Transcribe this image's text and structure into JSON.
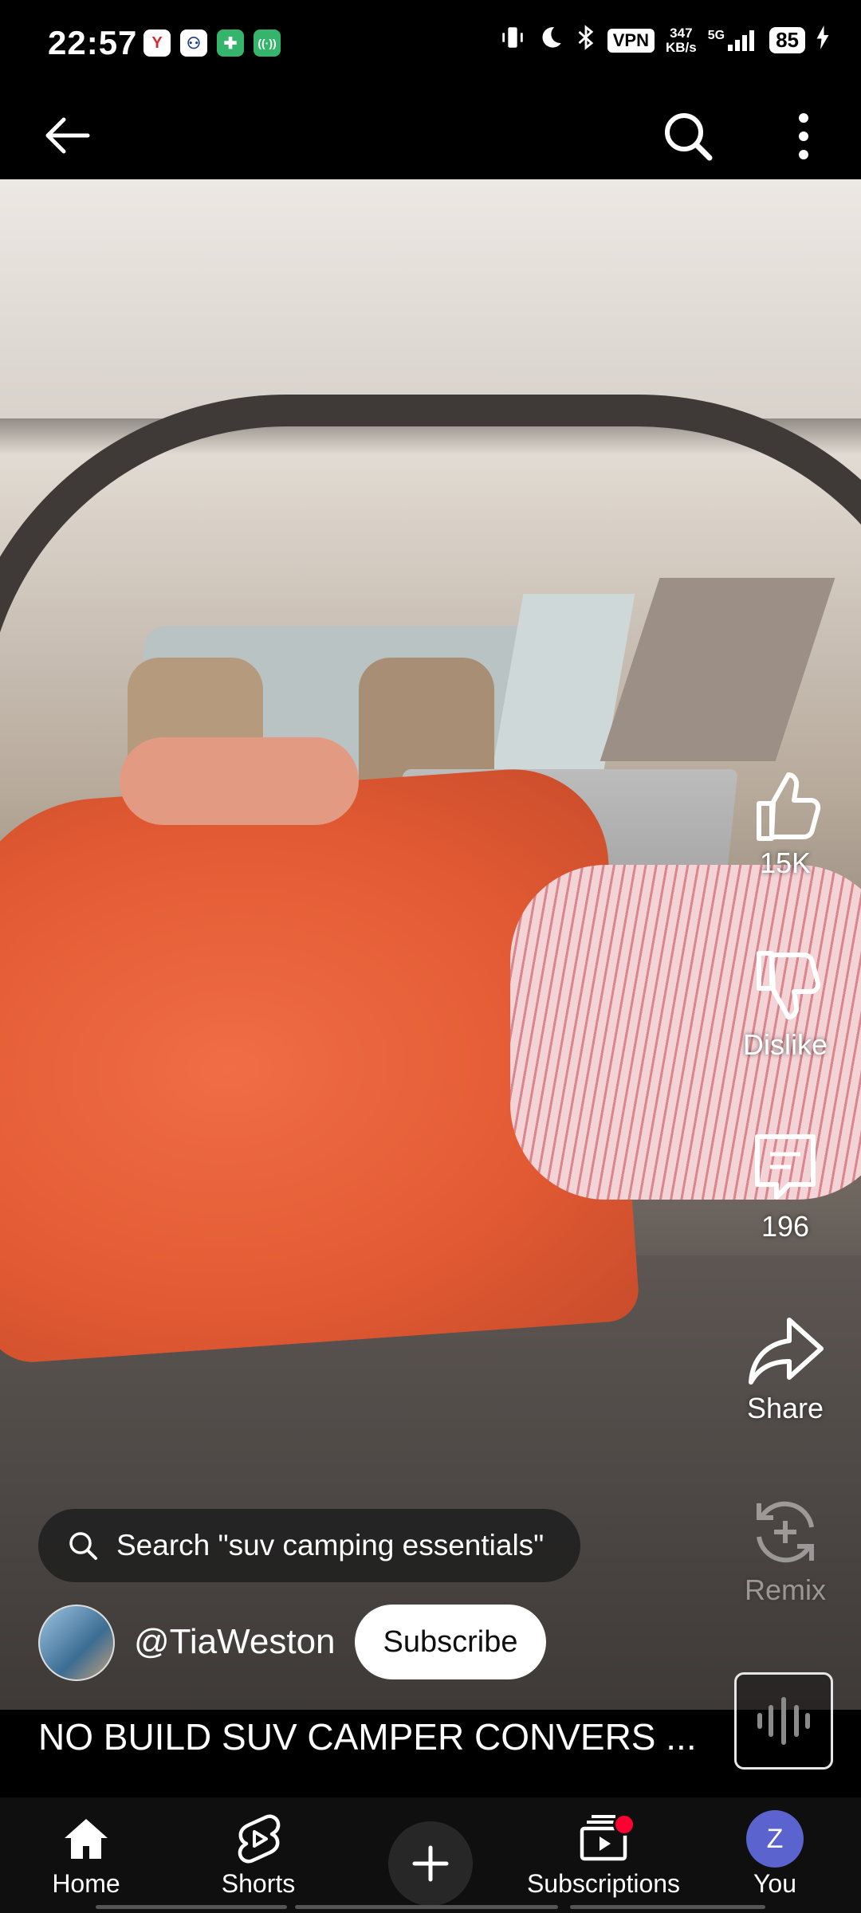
{
  "status_bar": {
    "time": "22:57",
    "app_badges": [
      "Y",
      "⚇",
      "✚",
      "((·))"
    ],
    "vpn": "VPN",
    "speed_value": "347",
    "speed_unit": "KB/s",
    "network": "5G",
    "battery": "85"
  },
  "top_bar": {
    "back_icon": "arrow-left-icon",
    "search_icon": "search-icon",
    "more_icon": "more-vert-icon"
  },
  "actions": {
    "like_count": "15K",
    "dislike_label": "Dislike",
    "comments_count": "196",
    "share_label": "Share",
    "remix_label": "Remix"
  },
  "search_suggestion": "Search \"suv camping essentials\"",
  "channel": {
    "handle": "@TiaWeston",
    "subscribe_label": "Subscribe"
  },
  "video_title": "NO BUILD SUV CAMPER CONVERS ...",
  "nav": {
    "home": "Home",
    "shorts": "Shorts",
    "subscriptions": "Subscriptions",
    "you": "You",
    "you_initial": "Z"
  },
  "colors": {
    "background": "#000000",
    "subscribe_bg": "#ffffff",
    "you_avatar": "#5b63cf",
    "notification_dot": "#ff0033"
  }
}
